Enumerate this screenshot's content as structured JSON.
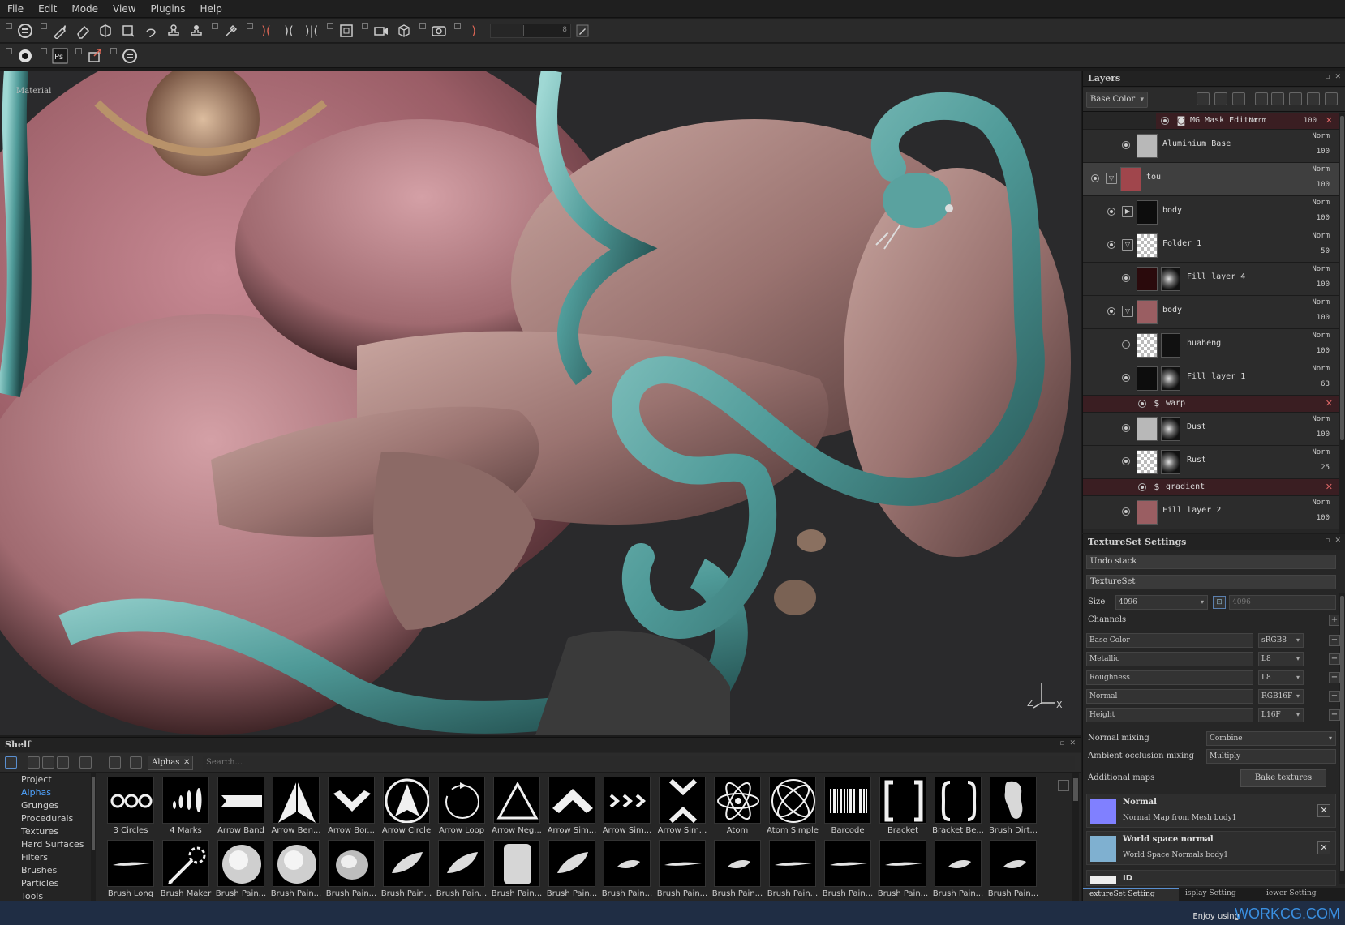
{
  "menu": [
    "File",
    "Edit",
    "Mode",
    "View",
    "Plugins",
    "Help"
  ],
  "toolbar": {
    "slider_value": "8"
  },
  "viewport": {
    "label": "Material",
    "axis_x": "X",
    "axis_z": "Z"
  },
  "layers": {
    "title": "Layers",
    "channel": "Base Color",
    "mask_editor": {
      "name": "MG Mask Editor",
      "blend": "Norm",
      "opacity": "100"
    },
    "rows": [
      {
        "type": "layer",
        "name": "Aluminium Base",
        "blend": "Norm",
        "opacity": "100",
        "indent": 3,
        "visible": true,
        "thumb": "grey",
        "folder": false
      },
      {
        "type": "layer",
        "name": "tou",
        "blend": "Norm",
        "opacity": "100",
        "indent": 1,
        "visible": true,
        "thumb": "red",
        "folder": true,
        "selected": true
      },
      {
        "type": "layer",
        "name": "body",
        "blend": "Norm",
        "opacity": "100",
        "indent": 2,
        "visible": true,
        "thumb": "black",
        "folder": "closed"
      },
      {
        "type": "layer",
        "name": "Folder 1",
        "blend": "Norm",
        "opacity": "50",
        "indent": 2,
        "visible": true,
        "thumb": "checker",
        "folder": true
      },
      {
        "type": "layer",
        "name": "Fill layer 4",
        "blend": "Norm",
        "opacity": "100",
        "indent": 3,
        "visible": true,
        "thumb": "darkred",
        "mask": "grunge"
      },
      {
        "type": "layer",
        "name": "body",
        "blend": "Norm",
        "opacity": "100",
        "indent": 2,
        "visible": true,
        "thumb": "pink",
        "folder": true
      },
      {
        "type": "layer",
        "name": "huaheng",
        "blend": "Norm",
        "opacity": "100",
        "indent": 3,
        "visible": false,
        "thumb": "checker",
        "mask": "black"
      },
      {
        "type": "layer",
        "name": "Fill layer 1",
        "blend": "Norm",
        "opacity": "63",
        "indent": 3,
        "visible": true,
        "thumb": "black",
        "mask": "grunge"
      },
      {
        "type": "effect",
        "name": "warp"
      },
      {
        "type": "layer",
        "name": "Dust",
        "blend": "Norm",
        "opacity": "100",
        "indent": 3,
        "visible": true,
        "thumb": "grey",
        "mask": "grunge"
      },
      {
        "type": "layer",
        "name": "Rust",
        "blend": "Norm",
        "opacity": "25",
        "indent": 3,
        "visible": true,
        "thumb": "checker",
        "mask": "grunge"
      },
      {
        "type": "effect",
        "name": "gradient"
      },
      {
        "type": "layer",
        "name": "Fill layer 2",
        "blend": "Norm",
        "opacity": "100",
        "indent": 3,
        "visible": true,
        "thumb": "pink"
      }
    ]
  },
  "textureset": {
    "title": "TextureSet Settings",
    "undo_stack": "Undo stack",
    "textureset_label": "TextureSet",
    "size_label": "Size",
    "size_value": "4096",
    "size_linked": "4096",
    "channels_label": "Channels",
    "channels": [
      {
        "name": "Base Color",
        "format": "sRGB8"
      },
      {
        "name": "Metallic",
        "format": "L8"
      },
      {
        "name": "Roughness",
        "format": "L8"
      },
      {
        "name": "Normal",
        "format": "RGB16F"
      },
      {
        "name": "Height",
        "format": "L16F"
      }
    ],
    "normal_mixing_label": "Normal mixing",
    "normal_mixing_value": "Combine",
    "ao_mixing_label": "Ambient occlusion mixing",
    "ao_mixing_value": "Multiply",
    "additional_maps_label": "Additional maps",
    "bake_button": "Bake textures",
    "maps": [
      {
        "title": "Normal",
        "sub": "Normal Map from Mesh body1",
        "color": "#8080ff"
      },
      {
        "title": "World space normal",
        "sub": "World Space Normals body1",
        "color": "#7fb0d0"
      }
    ],
    "partial_map": "ID",
    "tabs": [
      "extureSet Setting",
      "isplay Setting",
      "iewer Setting"
    ]
  },
  "shelf": {
    "title": "Shelf",
    "filter_chip": "Alphas",
    "search_placeholder": "Search...",
    "categories": [
      "Project",
      "Alphas",
      "Grunges",
      "Procedurals",
      "Textures",
      "Hard Surfaces",
      "Filters",
      "Brushes",
      "Particles",
      "Tools"
    ],
    "active_category": "Alphas",
    "row1": [
      {
        "name": "3 Circles",
        "icon": "circles3"
      },
      {
        "name": "4 Marks",
        "icon": "marks4"
      },
      {
        "name": "Arrow Band",
        "icon": "band"
      },
      {
        "name": "Arrow Ben...",
        "icon": "arrowbend"
      },
      {
        "name": "Arrow Bor...",
        "icon": "chevron"
      },
      {
        "name": "Arrow Circle",
        "icon": "arrowcircle"
      },
      {
        "name": "Arrow Loop",
        "icon": "loop"
      },
      {
        "name": "Arrow Neg...",
        "icon": "triangle"
      },
      {
        "name": "Arrow Sim...",
        "icon": "chevronup"
      },
      {
        "name": "Arrow Sim...",
        "icon": "chevrons"
      },
      {
        "name": "Arrow Sim...",
        "icon": "hourglass"
      },
      {
        "name": "Atom",
        "icon": "atom"
      },
      {
        "name": "Atom Simple",
        "icon": "atomsimple"
      },
      {
        "name": "Barcode",
        "icon": "barcode"
      },
      {
        "name": "Bracket",
        "icon": "bracket"
      },
      {
        "name": "Bracket Be...",
        "icon": "bracket2"
      },
      {
        "name": "Brush Dirt...",
        "icon": "dirt"
      }
    ],
    "row2": [
      {
        "name": "Brush Long",
        "icon": "stroke"
      },
      {
        "name": "Brush Maker",
        "icon": "maker"
      },
      {
        "name": "Brush Pain...",
        "icon": "blob"
      },
      {
        "name": "Brush Pain...",
        "icon": "blob"
      },
      {
        "name": "Brush Pain...",
        "icon": "blob2"
      },
      {
        "name": "Brush Pain...",
        "icon": "smear"
      },
      {
        "name": "Brush Pain...",
        "icon": "smear"
      },
      {
        "name": "Brush Pain...",
        "icon": "rect"
      },
      {
        "name": "Brush Pain...",
        "icon": "smear"
      },
      {
        "name": "Brush Pain...",
        "icon": "smallsmear"
      },
      {
        "name": "Brush Pain...",
        "icon": "stroke"
      },
      {
        "name": "Brush Pain...",
        "icon": "smallsmear"
      },
      {
        "name": "Brush Pain...",
        "icon": "stroke"
      },
      {
        "name": "Brush Pain...",
        "icon": "stroke"
      },
      {
        "name": "Brush Pain...",
        "icon": "stroke"
      },
      {
        "name": "Brush Pain...",
        "icon": "smallsmear"
      },
      {
        "name": "Brush Pain...",
        "icon": "smallsmear"
      }
    ]
  },
  "status": {
    "enjoy": "Enjoy using",
    "brand": "WORKCG.COM"
  }
}
